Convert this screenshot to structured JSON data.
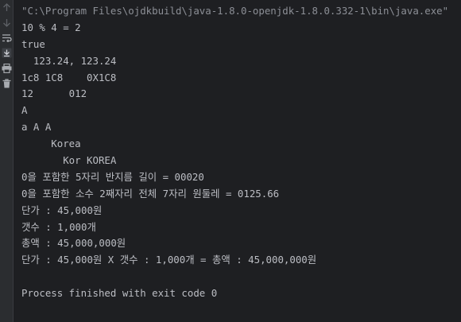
{
  "console": {
    "lines": [
      "\"C:\\Program Files\\ojdkbuild\\java-1.8.0-openjdk-1.8.0.332-1\\bin\\java.exe\"",
      "10 % 4 = 2",
      "true",
      "  123.24, 123.24",
      "1c8 1C8    0X1C8",
      "12      012",
      "A",
      "a A A",
      "     Korea",
      "       Kor KOREA",
      "0을 포함한 5자리 반지름 길이 = 00020",
      "0을 포함한 소수 2째자리 전체 7자리 원둘레 = 0125.66",
      "단가 : 45,000원",
      "갯수 : 1,000개",
      "총액 : 45,000,000원",
      "단가 : 45,000원 X 갯수 : 1,000개 = 총액 : 45,000,000원",
      "",
      "Process finished with exit code 0"
    ]
  },
  "toolbar": {
    "icons": [
      "arrow-up-icon",
      "arrow-down-icon",
      "soft-wrap-icon",
      "scroll-to-end-icon",
      "print-icon",
      "trash-icon"
    ]
  },
  "colors": {
    "background": "#1e1f22",
    "gutter": "#2b2d30",
    "text": "#bcbec4",
    "command": "#8c8f96"
  }
}
